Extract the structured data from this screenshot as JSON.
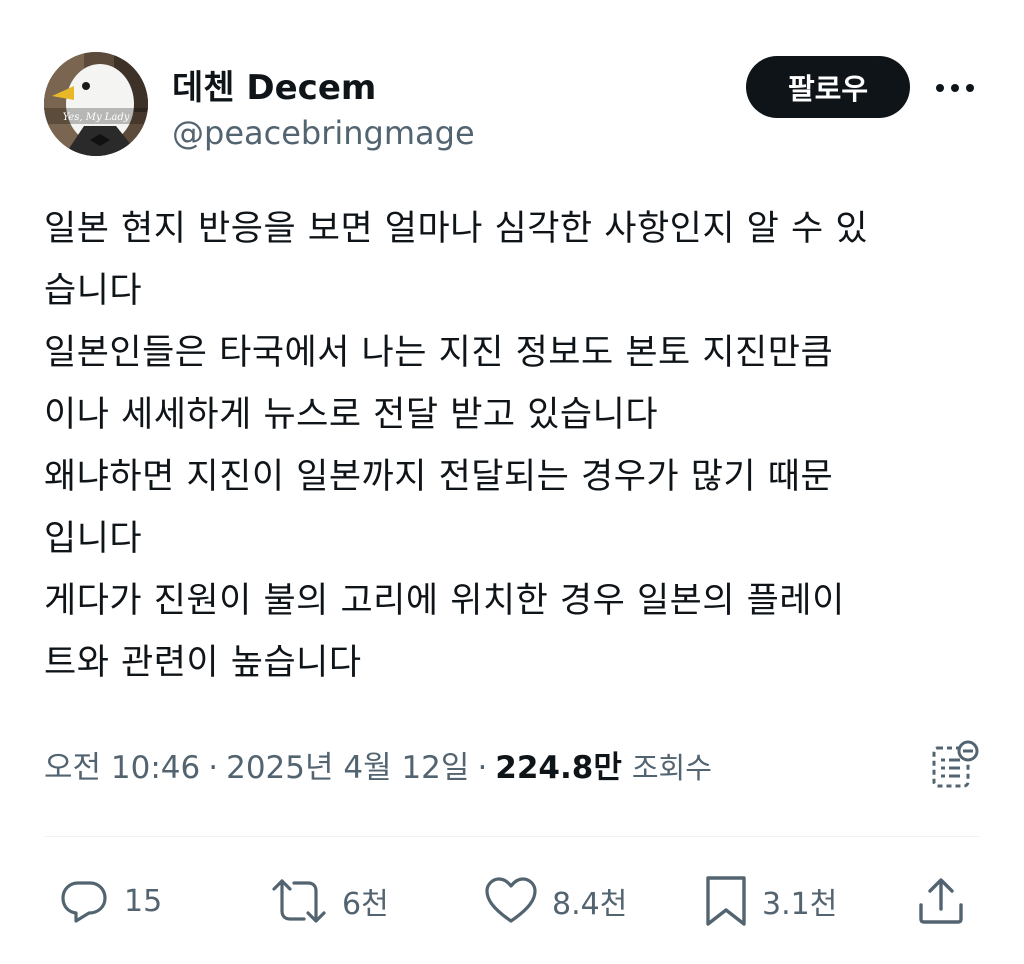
{
  "author": {
    "display_name": "데첸 Decem",
    "handle": "@peacebringmage",
    "avatar_caption": "Yes, My Lady"
  },
  "follow_label": "팔로우",
  "tweet_lines": [
    "일본 현지 반응을 보면 얼마나 심각한 사항인지 알 수 있",
    "습니다",
    "일본인들은 타국에서 나는 지진 정보도 본토 지진만큼",
    "이나 세세하게 뉴스로 전달 받고 있습니다",
    "왜냐하면 지진이 일본까지 전달되는 경우가 많기 때문",
    "입니다",
    "게다가 진원이 불의 고리에 위치한 경우 일본의 플레이",
    "트와 관련이 높습니다"
  ],
  "meta": {
    "time": "오전 10:46",
    "separator": "·",
    "date": "2025년 4월 12일",
    "views_count": "224.8만",
    "views_label": "조회수"
  },
  "actions": {
    "replies": "15",
    "reposts": "6천",
    "likes": "8.4천",
    "bookmarks": "3.1천"
  },
  "icons": {
    "more": "more-horizontal-icon",
    "grok": "grok-explain-icon",
    "reply": "reply-bubble-icon",
    "repost": "repost-arrows-icon",
    "like": "heart-icon",
    "bookmark": "bookmark-icon",
    "share": "share-upload-icon"
  },
  "colors": {
    "text_primary": "#0f1419",
    "text_secondary": "#536471",
    "follow_button_bg": "#0f1419",
    "divider": "#eff3f4"
  }
}
